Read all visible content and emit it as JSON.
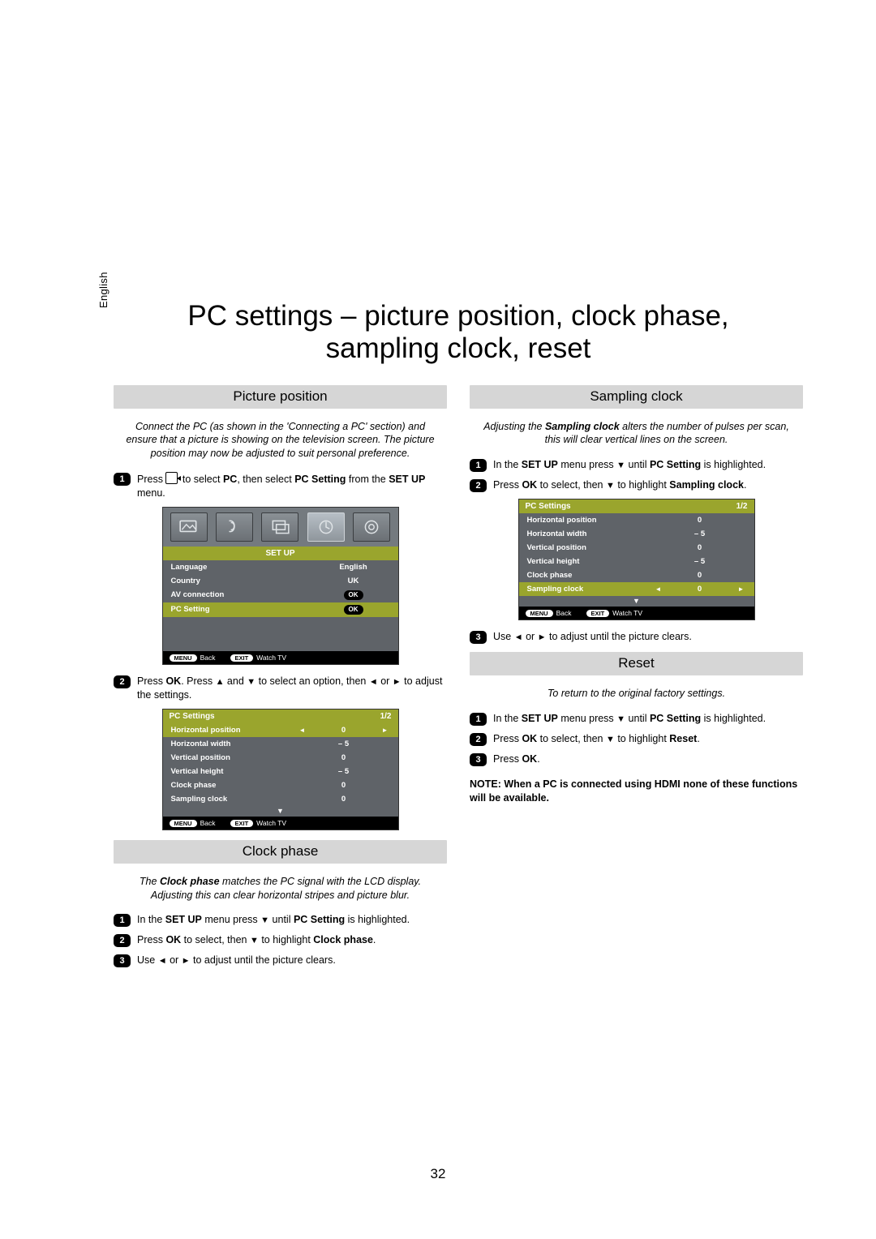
{
  "language_tab": "English",
  "title_line1": "PC settings – picture position, clock phase,",
  "title_line2": "sampling clock, reset",
  "page_number": "32",
  "picture_position": {
    "heading": "Picture position",
    "intro": "Connect the PC (as shown in the 'Connecting a PC' section) and ensure that a picture is showing on the television screen. The picture position may now be adjusted to suit personal preference.",
    "step1_pre": "Press ",
    "step1_mid": " to select ",
    "step1_pc": "PC",
    "step1_then": ", then select ",
    "step1_pcsetting": "PC Setting",
    "step1_post": " from the ",
    "step1_menu": "SET UP",
    "step1_end": " menu.",
    "step2_pre": "Press ",
    "step2_ok": "OK",
    "step2_a": ". Press ",
    "step2_b": " and ",
    "step2_c": " to select an option, then ",
    "step2_d": " or ",
    "step2_e": " to adjust the settings."
  },
  "clock_phase": {
    "heading": "Clock phase",
    "intro_a": "The ",
    "intro_bold": "Clock phase",
    "intro_b": " matches the PC signal with the LCD display. Adjusting this can clear horizontal stripes and picture blur.",
    "step1_pre": "In the ",
    "step1_menu": "SET UP",
    "step1_mid": " menu press ",
    "step1_post": " until ",
    "step1_pcs": "PC Setting",
    "step1_end": " is highlighted.",
    "step2_pre": "Press ",
    "step2_ok": "OK",
    "step2_a": " to select, then ",
    "step2_b": " to highlight ",
    "step2_bold": "Clock phase",
    "step2_end": ".",
    "step3_a": "Use ",
    "step3_b": " or ",
    "step3_c": " to adjust until the picture clears."
  },
  "sampling_clock": {
    "heading": "Sampling clock",
    "intro_a": "Adjusting the ",
    "intro_bold": "Sampling clock",
    "intro_b": " alters the number of pulses per scan, this will clear vertical lines on the screen.",
    "step1_pre": "In the ",
    "step1_menu": "SET UP",
    "step1_mid": " menu press ",
    "step1_post": " until ",
    "step1_pcs": "PC Setting",
    "step1_end": " is highlighted.",
    "step2_pre": "Press ",
    "step2_ok": "OK",
    "step2_a": " to select, then ",
    "step2_b": " to highlight ",
    "step2_bold": "Sampling clock",
    "step2_end": ".",
    "step3_a": "Use ",
    "step3_b": " or ",
    "step3_c": " to adjust until the picture clears."
  },
  "reset": {
    "heading": "Reset",
    "intro": "To return to the original factory settings.",
    "step1_pre": "In the ",
    "step1_menu": "SET UP",
    "step1_mid": " menu press ",
    "step1_post": " until ",
    "step1_pcs": "PC Setting",
    "step1_end": " is highlighted.",
    "step2_pre": "Press ",
    "step2_ok": "OK",
    "step2_a": " to select, then ",
    "step2_b": " to highlight ",
    "step2_bold": "Reset",
    "step2_end": ".",
    "step3_a": "Press ",
    "step3_ok": "OK",
    "step3_end": "."
  },
  "note": "NOTE: When a PC is connected using HDMI none of these functions will be available.",
  "osd_setup": {
    "title": "SET UP",
    "rows": [
      {
        "label": "Language",
        "value": "English"
      },
      {
        "label": "Country",
        "value": "UK"
      },
      {
        "label": "AV connection",
        "value": "OK"
      },
      {
        "label": "PC Setting",
        "value": "OK"
      }
    ],
    "footer_back": "Back",
    "footer_exit": "Watch TV",
    "key_menu": "MENU",
    "key_exit": "EXIT"
  },
  "osd_pcs": {
    "title": "PC Settings",
    "page": "1/2",
    "rows": [
      {
        "label": "Horizontal position",
        "value": "0"
      },
      {
        "label": "Horizontal width",
        "value": "– 5"
      },
      {
        "label": "Vertical position",
        "value": "0"
      },
      {
        "label": "Vertical height",
        "value": "– 5"
      },
      {
        "label": "Clock phase",
        "value": "0"
      },
      {
        "label": "Sampling clock",
        "value": "0"
      }
    ],
    "footer_back": "Back",
    "footer_exit": "Watch TV",
    "key_menu": "MENU",
    "key_exit": "EXIT"
  }
}
